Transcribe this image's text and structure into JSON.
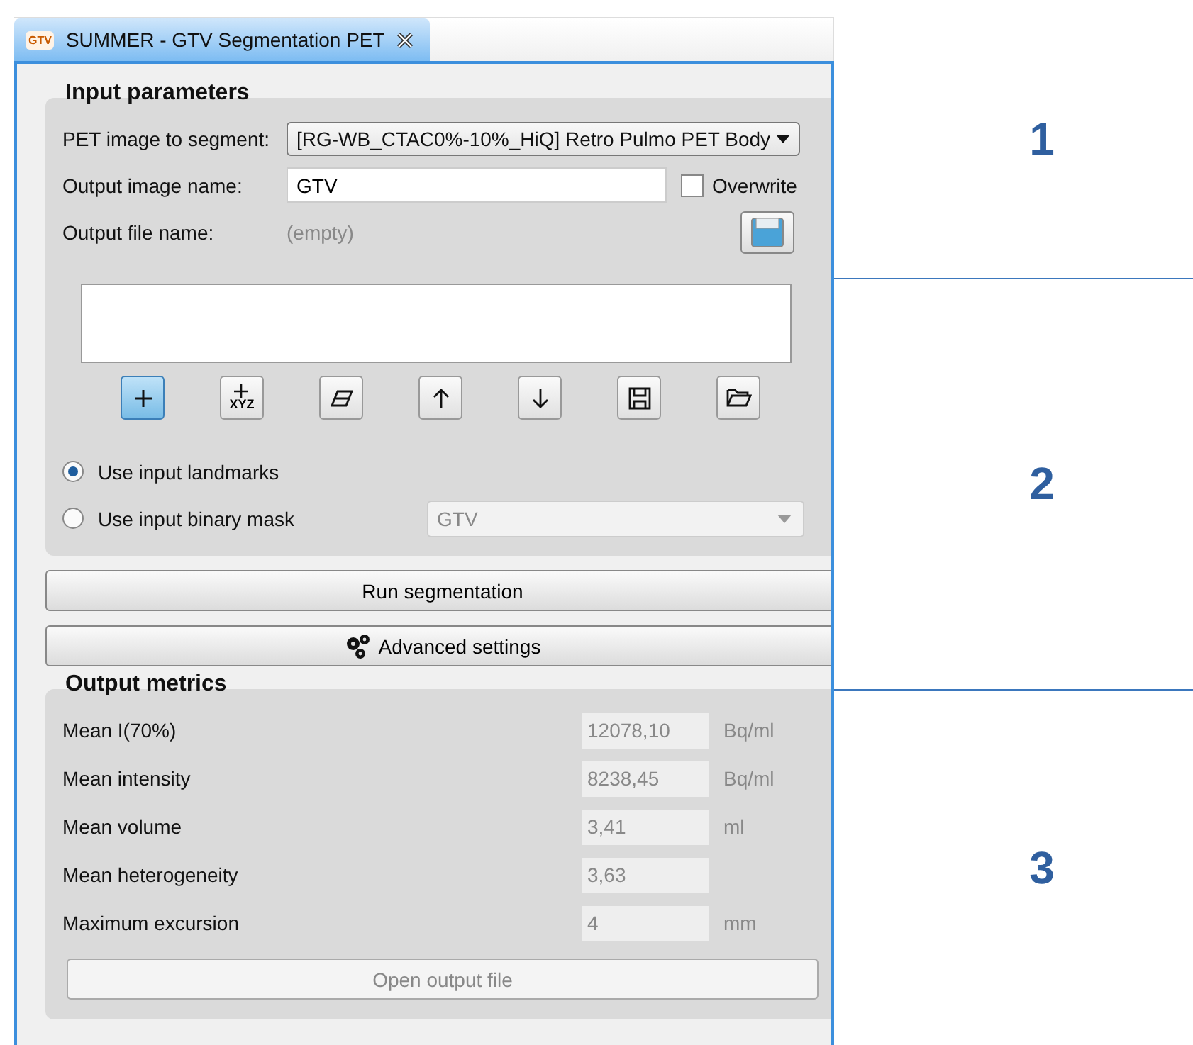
{
  "tab": {
    "logo_text": "GTV",
    "title": "SUMMER - GTV Segmentation PET",
    "selected": true
  },
  "input_parameters": {
    "title": "Input parameters",
    "pet_label": "PET image to segment:",
    "pet_value": "[RG-WB_CTAC0%-10%_HiQ] Retro Pulmo PET Body",
    "output_name_label": "Output image name:",
    "output_name_value": "GTV",
    "overwrite": {
      "label": "Overwrite",
      "checked": false
    },
    "output_file_label": "Output file name:",
    "output_file_value": "(empty)",
    "toolbar": [
      {
        "kind": "plus",
        "selected": true
      },
      {
        "kind": "plus-xyz",
        "text": "XYZ",
        "selected": false
      },
      {
        "kind": "eraser",
        "selected": false
      },
      {
        "kind": "up",
        "selected": false
      },
      {
        "kind": "down",
        "selected": false
      },
      {
        "kind": "save",
        "selected": false
      },
      {
        "kind": "folder",
        "selected": false
      }
    ],
    "source_options": [
      {
        "label": "Use input landmarks",
        "selected": true
      },
      {
        "label": "Use input binary mask",
        "selected": false
      }
    ],
    "mask_dropdown": {
      "value": "GTV",
      "disabled": true
    }
  },
  "buttons": [
    {
      "label": "Run segmentation",
      "kind": "plain"
    },
    {
      "label": "Advanced settings",
      "kind": "gears"
    }
  ],
  "output_metrics": {
    "title": "Output metrics",
    "rows": [
      {
        "label": "Mean I(70%)",
        "value": "12078,10",
        "unit": "Bq/ml"
      },
      {
        "label": "Mean intensity",
        "value": "8238,45",
        "unit": "Bq/ml"
      },
      {
        "label": "Mean volume",
        "value": "3,41",
        "unit": "ml"
      },
      {
        "label": "Mean heterogeneity",
        "value": "3,63"
      },
      {
        "label": "Maximum excursion",
        "value": "4",
        "unit": "mm"
      }
    ],
    "open_button": {
      "label": "Open output file",
      "disabled": true
    }
  },
  "annotations": [
    "1",
    "2",
    "3"
  ]
}
